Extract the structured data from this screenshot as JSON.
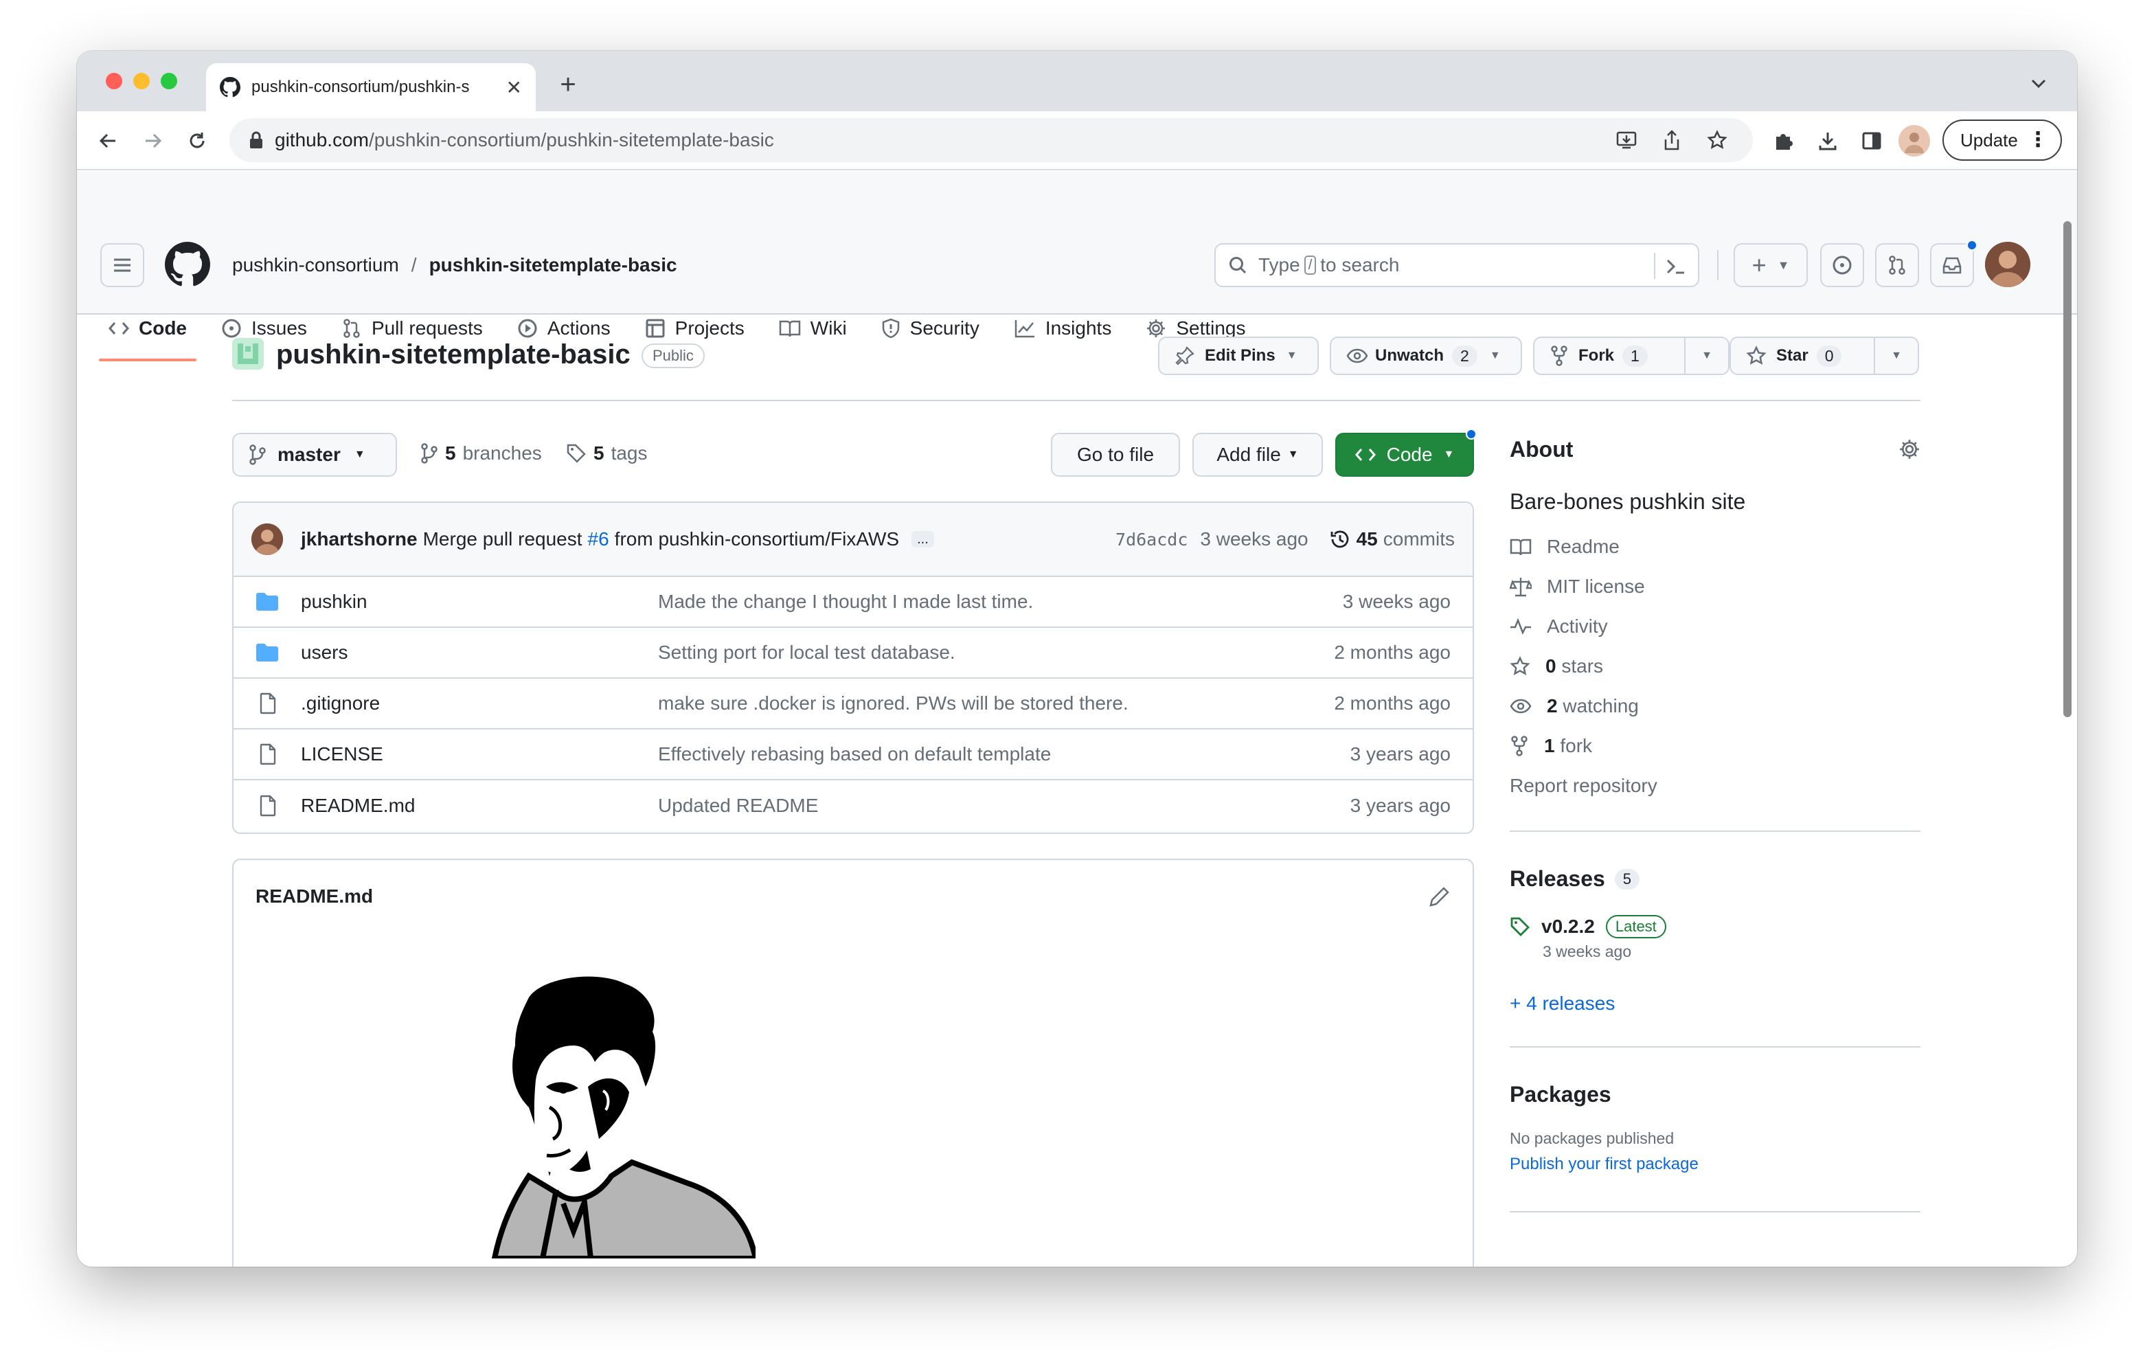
{
  "browser": {
    "tab_title": "pushkin-consortium/pushkin-s",
    "url_host": "github.com",
    "url_path": "/pushkin-consortium/pushkin-sitetemplate-basic",
    "update_label": "Update"
  },
  "header": {
    "owner": "pushkin-consortium",
    "separator": "/",
    "repo": "pushkin-sitetemplate-basic",
    "search_prefix": "Type",
    "search_key": "/",
    "search_suffix": "to search"
  },
  "nav": {
    "code": "Code",
    "issues": "Issues",
    "pull_requests": "Pull requests",
    "actions": "Actions",
    "projects": "Projects",
    "wiki": "Wiki",
    "security": "Security",
    "insights": "Insights",
    "settings": "Settings"
  },
  "repo_header": {
    "name": "pushkin-sitetemplate-basic",
    "visibility": "Public",
    "edit_pins": "Edit Pins",
    "unwatch": "Unwatch",
    "unwatch_count": "2",
    "fork": "Fork",
    "fork_count": "1",
    "star": "Star",
    "star_count": "0"
  },
  "branch_bar": {
    "branch": "master",
    "branches_count": "5",
    "branches_label": "branches",
    "tags_count": "5",
    "tags_label": "tags",
    "go_to_file": "Go to file",
    "add_file": "Add file",
    "code": "Code"
  },
  "commit": {
    "author": "jkhartshorne",
    "message_a": "Merge pull request",
    "pr": "#6",
    "message_b": "from pushkin-consortium/FixAWS",
    "ellipsis": "...",
    "sha": "7d6acdc",
    "age": "3 weeks ago",
    "commits_count": "45",
    "commits_label": "commits"
  },
  "files": [
    {
      "name": "pushkin",
      "type": "folder",
      "message": "Made the change I thought I made last time.",
      "age": "3 weeks ago"
    },
    {
      "name": "users",
      "type": "folder",
      "message": "Setting port for local test database.",
      "age": "2 months ago"
    },
    {
      "name": ".gitignore",
      "type": "file",
      "message": "make sure .docker is ignored. PWs will be stored there.",
      "age": "2 months ago"
    },
    {
      "name": "LICENSE",
      "type": "file",
      "message": "Effectively rebasing based on default template",
      "age": "3 years ago"
    },
    {
      "name": "README.md",
      "type": "file",
      "message": "Updated README",
      "age": "3 years ago"
    }
  ],
  "readme": {
    "title": "README.md"
  },
  "about": {
    "heading": "About",
    "description": "Bare-bones pushkin site",
    "readme": "Readme",
    "license": "MIT license",
    "activity": "Activity",
    "stars_count": "0",
    "stars_label": "stars",
    "watching_count": "2",
    "watching_label": "watching",
    "fork_count": "1",
    "fork_label": "fork",
    "report": "Report repository"
  },
  "releases": {
    "heading": "Releases",
    "count": "5",
    "latest_tag": "v0.2.2",
    "latest_badge": "Latest",
    "latest_age": "3 weeks ago",
    "more": "+ 4 releases"
  },
  "packages": {
    "heading": "Packages",
    "none": "No packages published",
    "publish": "Publish your first package"
  },
  "colors": {
    "accent": "#0969da",
    "code_button": "#1f883d",
    "nav_underline": "#fd8c73",
    "folder": "#54aeff"
  }
}
